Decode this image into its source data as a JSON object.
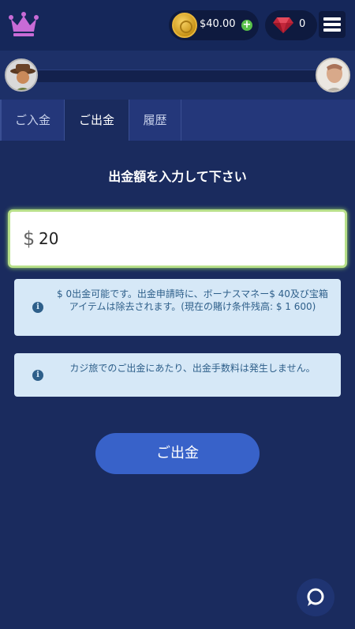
{
  "header": {
    "balance": "$40.00",
    "gems": "0",
    "plus_symbol": "+",
    "logo_icon": "crown-icon",
    "coin_icon": "coin-icon",
    "gem_icon": "ruby-gem-icon",
    "menu_icon": "hamburger-menu-icon"
  },
  "tabs": [
    {
      "label": "ご入金"
    },
    {
      "label": "ご出金"
    },
    {
      "label": "履歴"
    }
  ],
  "active_tab": "ご出金",
  "form": {
    "heading": "出金額を入力して下さい",
    "currency_symbol": "$",
    "amount_value": "20"
  },
  "notices": [
    {
      "icon": "i",
      "text": "$ 0出金可能です。出金申請時に、ボーナスマネー$ 40及び宝箱アイテムは除去されます。(現在の賭け条件残高: $ 1 600)"
    },
    {
      "icon": "i",
      "text": "カジ旅でのご出金にあたり、出金手数料は発生しません。"
    }
  ],
  "actions": {
    "withdraw_label": "ご出金"
  },
  "colors": {
    "background": "#1a2b5e",
    "accent_button": "#3862c9",
    "logo_pink": "#c86bd6",
    "input_glow": "#b8e08a",
    "notice_bg": "#d6e8f7"
  }
}
